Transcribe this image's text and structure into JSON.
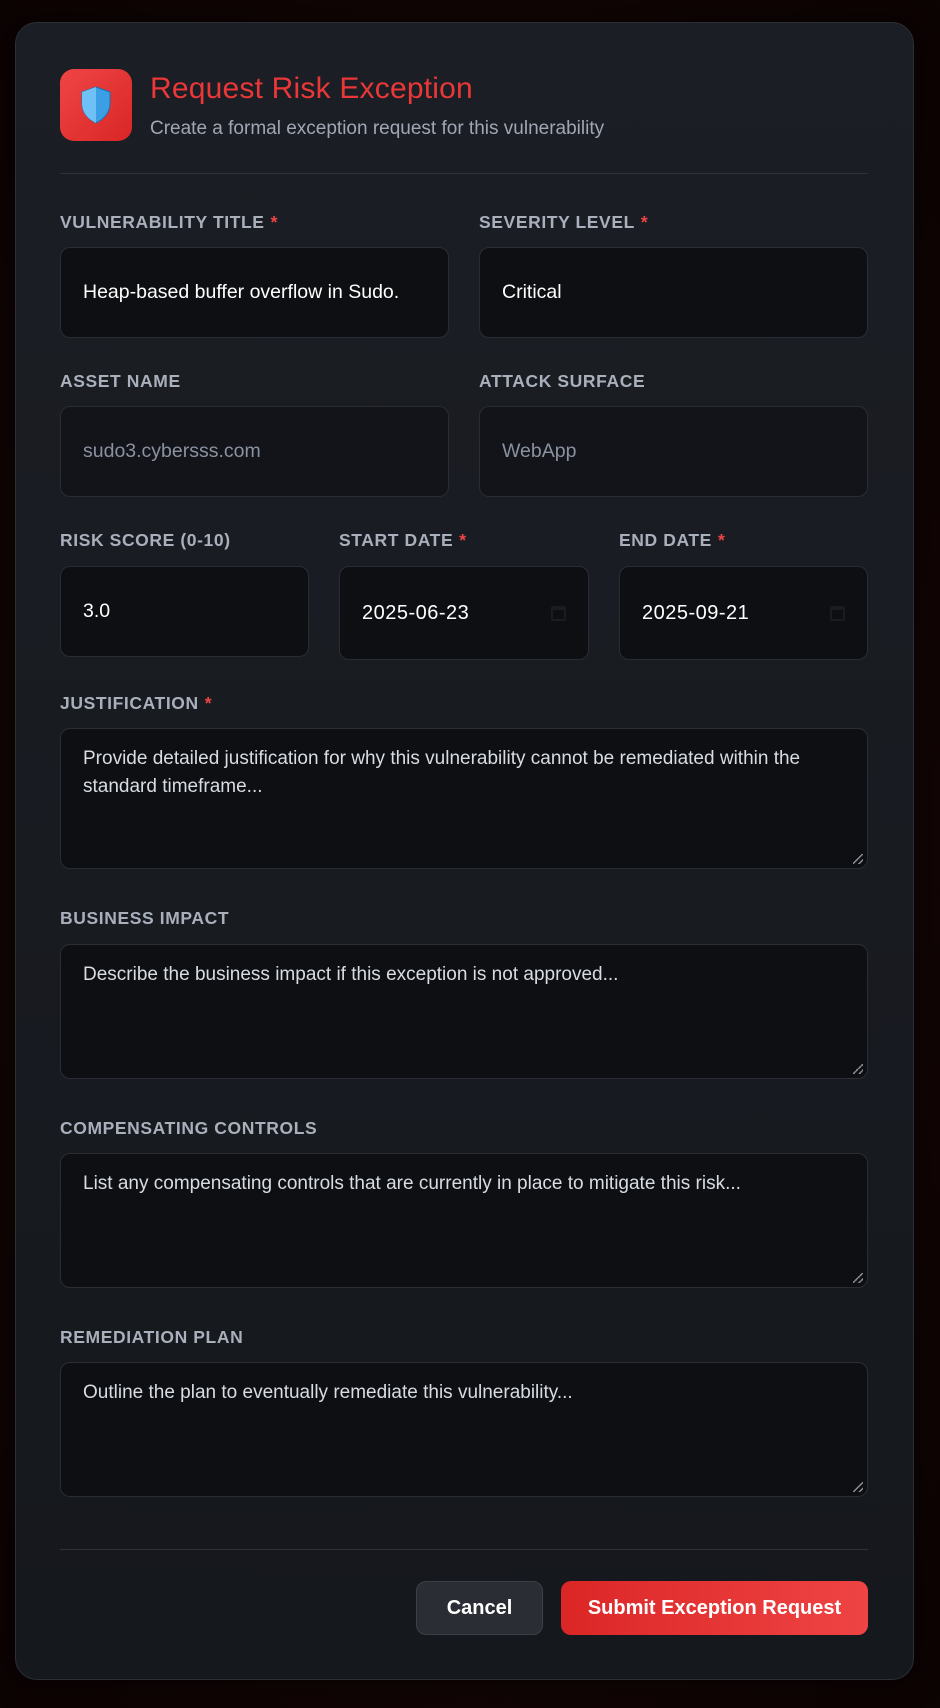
{
  "dialog": {
    "title": "Request Risk Exception",
    "subtitle": "Create a formal exception request for this vulnerability",
    "icon": "shield-icon",
    "accent_color": "#ea3737"
  },
  "form": {
    "required_marker": "*",
    "vulnerability_title": {
      "label": "VULNERABILITY TITLE",
      "value": "Heap-based buffer overflow in Sudo."
    },
    "severity_level": {
      "label": "SEVERITY LEVEL",
      "value": "Critical"
    },
    "asset_name": {
      "label": "ASSET NAME",
      "value": "sudo3.cybersss.com"
    },
    "attack_surface": {
      "label": "ATTACK SURFACE",
      "value": "WebApp"
    },
    "risk_score": {
      "label": "RISK SCORE (0-10)",
      "value": "3.0"
    },
    "start_date": {
      "label": "START DATE",
      "value": "2025-06-23"
    },
    "end_date": {
      "label": "END DATE",
      "value": "2025-09-21"
    },
    "justification": {
      "label": "JUSTIFICATION",
      "placeholder": "Provide detailed justification for why this vulnerability cannot be remediated within the standard timeframe..."
    },
    "business_impact": {
      "label": "BUSINESS IMPACT",
      "placeholder": "Describe the business impact if this exception is not approved..."
    },
    "compensating_controls": {
      "label": "COMPENSATING CONTROLS",
      "placeholder": "List any compensating controls that are currently in place to mitigate this risk..."
    },
    "remediation_plan": {
      "label": "REMEDIATION PLAN",
      "placeholder": "Outline the plan to eventually remediate this vulnerability..."
    }
  },
  "actions": {
    "cancel_label": "Cancel",
    "submit_label": "Submit Exception Request"
  }
}
